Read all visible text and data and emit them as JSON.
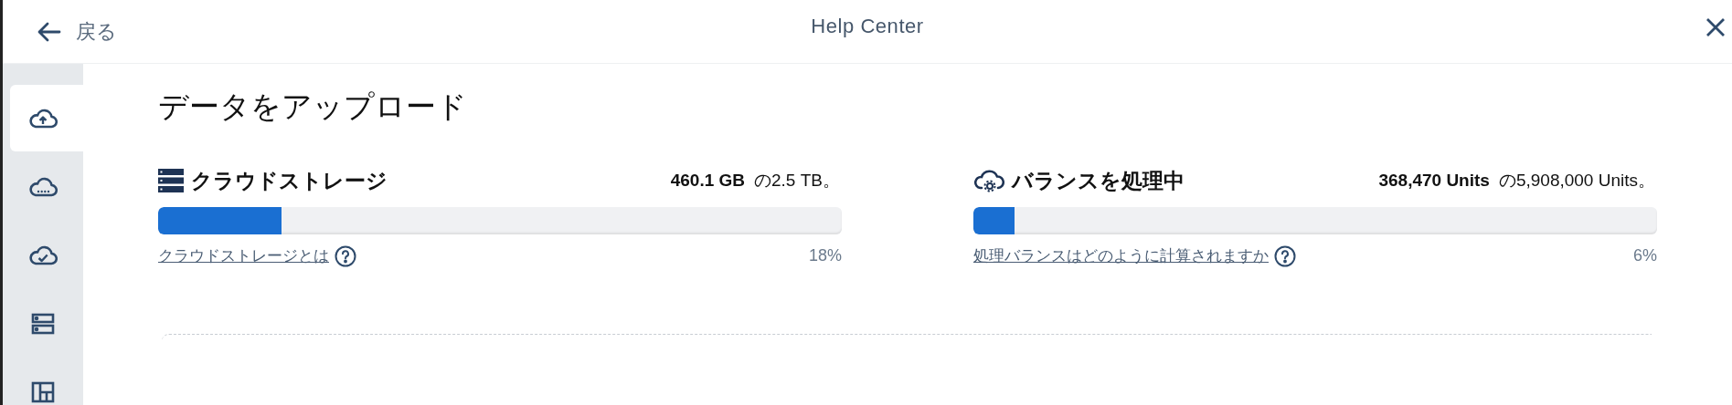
{
  "header": {
    "back_label": "戻る",
    "title": "Help Center"
  },
  "sidebar": {
    "items": [
      {
        "kind": "upload",
        "selected": true
      },
      {
        "kind": "pending",
        "selected": false
      },
      {
        "kind": "done",
        "selected": false
      },
      {
        "kind": "storage",
        "selected": false
      },
      {
        "kind": "layout",
        "selected": false
      }
    ]
  },
  "page_title": "データをアップロード",
  "cards": [
    {
      "kind": "storage",
      "title": "クラウドストレージ",
      "used": "460.1 GB",
      "total": "の2.5 TB。",
      "level": 0.18,
      "link": "クラウドストレージとは",
      "percent": "18%"
    },
    {
      "kind": "balance",
      "title": "バランスを処理中",
      "used": "368,470 Units",
      "total": "の5,908,000 Units。",
      "level": 0.06,
      "link": "処理バランスはどのように計算されますか",
      "percent": "6%"
    }
  ]
}
